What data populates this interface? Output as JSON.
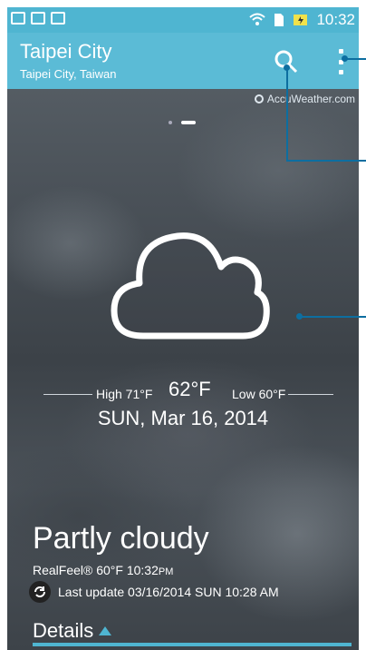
{
  "status_bar": {
    "time": "10:32"
  },
  "app_bar": {
    "title": "Taipei City",
    "subtitle": "Taipei City, Taiwan"
  },
  "provider": "AccuWeather.com",
  "weather": {
    "high": "High 71°F",
    "current": "62°F",
    "low": "Low 60°F",
    "date": "SUN, Mar 16, 2014",
    "condition": "Partly cloudy",
    "realfeel": "RealFeel® 60°F  10:32",
    "realfeel_pm": "PM",
    "last_update": "Last update 03/16/2014 SUN 10:28 AM"
  },
  "details_label": "Details",
  "colors": {
    "accent": "#4fb5d1",
    "callout": "#0d6ea0"
  }
}
